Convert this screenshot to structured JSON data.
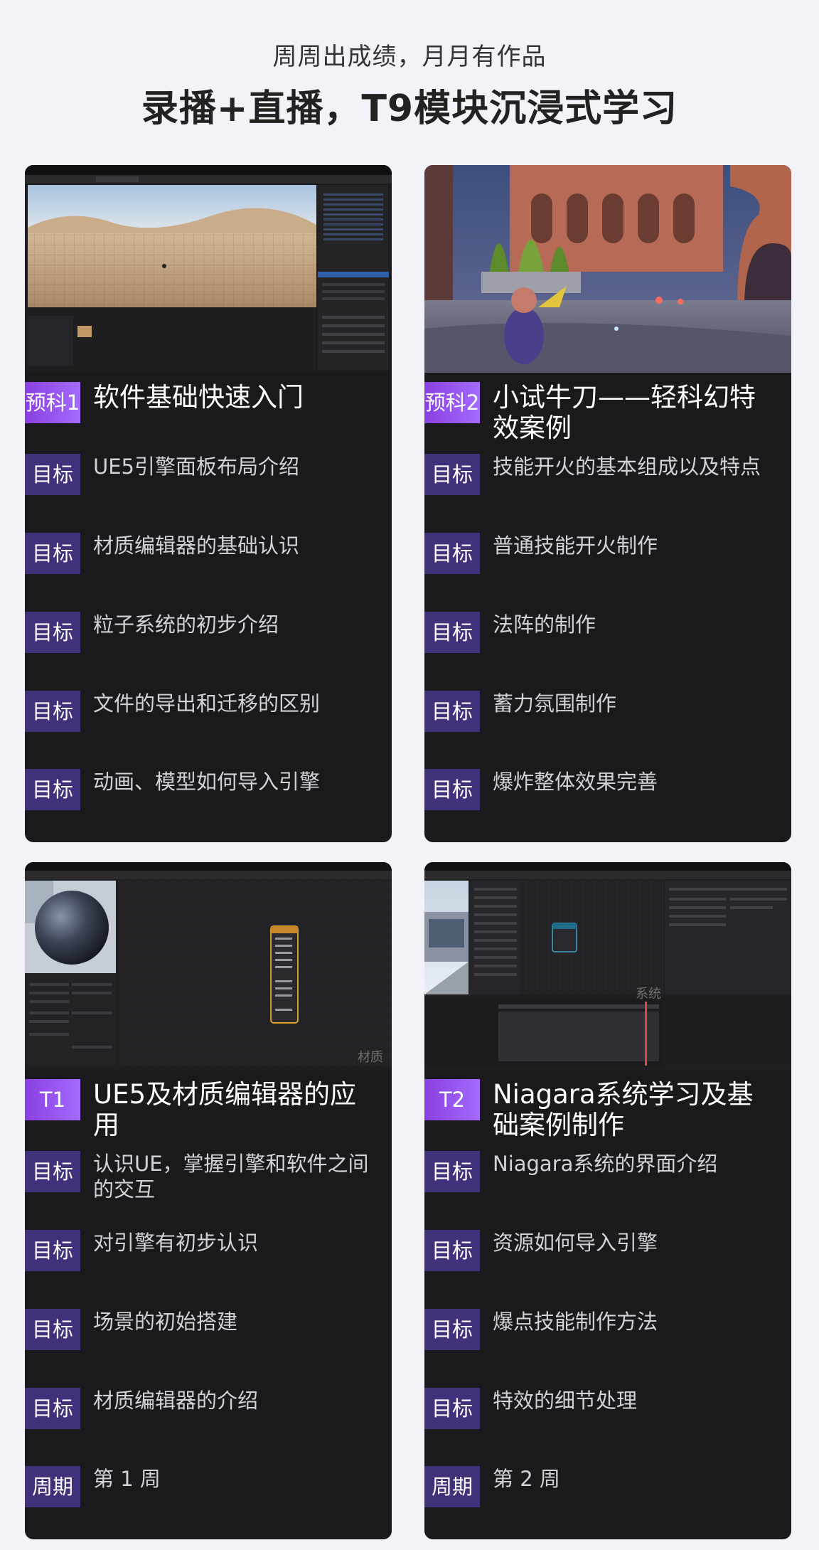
{
  "header": {
    "subtitle": "周周出成绩，月月有作品",
    "title": "录播+直播，T9模块沉浸式学习"
  },
  "cards": [
    {
      "badge": "预科1",
      "heading": "软件基础快速入门",
      "rows": [
        {
          "label": "目标",
          "text": "UE5引擎面板布局介绍"
        },
        {
          "label": "目标",
          "text": "材质编辑器的基础认识"
        },
        {
          "label": "目标",
          "text": "粒子系统的初步介绍"
        },
        {
          "label": "目标",
          "text": "文件的导出和迁移的区别"
        },
        {
          "label": "目标",
          "text": "动画、模型如何导入引擎"
        }
      ]
    },
    {
      "badge": "预科2",
      "heading": "小试牛刀——轻科幻特效案例",
      "rows": [
        {
          "label": "目标",
          "text": "技能开火的基本组成以及特点"
        },
        {
          "label": "目标",
          "text": "普通技能开火制作"
        },
        {
          "label": "目标",
          "text": "法阵的制作"
        },
        {
          "label": "目标",
          "text": "蓄力氛围制作"
        },
        {
          "label": "目标",
          "text": "爆炸整体效果完善"
        }
      ]
    },
    {
      "badge": "T1",
      "heading": "UE5及材质编辑器的应用",
      "watermark": "材质",
      "rows": [
        {
          "label": "目标",
          "text": "认识UE，掌握引擎和软件之间的交互"
        },
        {
          "label": "目标",
          "text": "对引擎有初步认识"
        },
        {
          "label": "目标",
          "text": "场景的初始搭建"
        },
        {
          "label": "目标",
          "text": "材质编辑器的介绍"
        },
        {
          "label": "周期",
          "text": "第 1 周"
        }
      ]
    },
    {
      "badge": "T2",
      "heading": "Niagara系统学习及基础案例制作",
      "watermark": "系统",
      "rows": [
        {
          "label": "目标",
          "text": "Niagara系统的界面介绍"
        },
        {
          "label": "目标",
          "text": "资源如何导入引擎"
        },
        {
          "label": "目标",
          "text": "爆点技能制作方法"
        },
        {
          "label": "目标",
          "text": "特效的细节处理"
        },
        {
          "label": "周期",
          "text": "第 2 周"
        }
      ]
    }
  ],
  "colors": {
    "page_bg": "#f3f2f8",
    "card_bg": "#1a191c",
    "badge_purple": "#41307a",
    "badge_gradient_start": "#8a3fe0",
    "badge_gradient_end": "#a46bff"
  }
}
